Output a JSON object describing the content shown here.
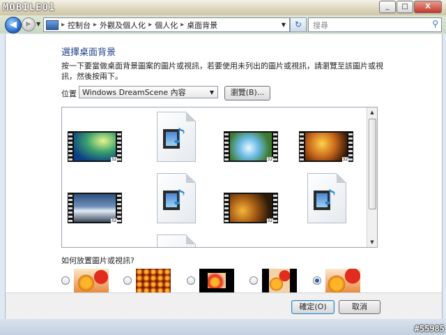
{
  "logo": "MOBILE01",
  "window": {
    "minimize": "_",
    "maximize": "□",
    "close": "X"
  },
  "nav": {
    "breadcrumbs": [
      "控制台",
      "外觀及個人化",
      "個人化",
      "桌面背景"
    ],
    "search_placeholder": "搜尋"
  },
  "page": {
    "title": "選擇桌面背景",
    "description": "按一下要當做桌面背景圖案的圖片或視訊，若要使用未列出的圖片或視訊，請瀏覽至該圖片或視訊，然後按兩下。",
    "location_label": "位置",
    "location_value": "Windows DreamScene 內容",
    "browse_label": "瀏覽(B)...",
    "position_question": "如何放置圖片或視訊?",
    "selected_position_index": 4
  },
  "gallery": {
    "items": [
      {
        "kind": "video",
        "theme": "aurora",
        "badge": "321"
      },
      {
        "kind": "file"
      },
      {
        "kind": "video",
        "theme": "waterdrop",
        "badge": "321"
      },
      {
        "kind": "video",
        "theme": "autumn",
        "badge": "321"
      },
      {
        "kind": "video",
        "theme": "mountain",
        "badge": "321"
      },
      {
        "kind": "file"
      },
      {
        "kind": "video",
        "theme": "sunflowers",
        "badge": "321"
      },
      {
        "kind": "file"
      }
    ]
  },
  "footer": {
    "ok_label": "確定(O)",
    "cancel_label": "取消"
  },
  "watermark": "#55985",
  "colors": {
    "heading": "#1e3f8c",
    "accent": "#2a5aa8"
  }
}
